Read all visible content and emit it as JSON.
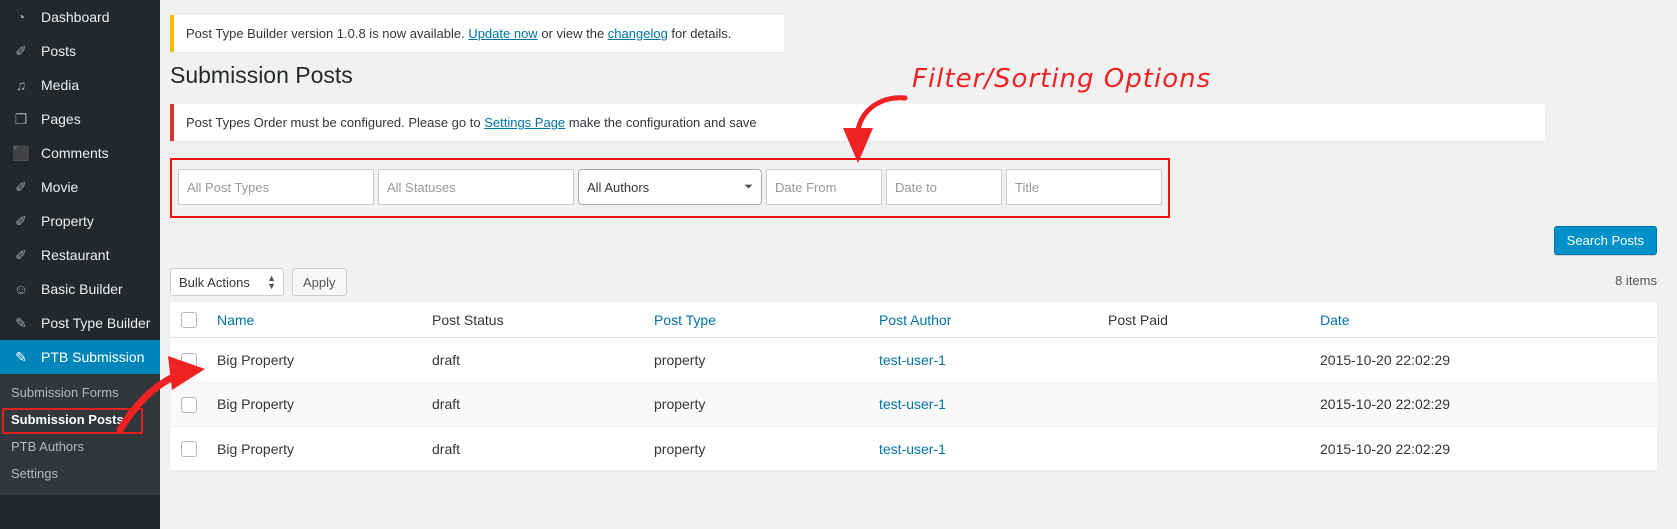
{
  "sidebar": {
    "items": [
      {
        "label": "Dashboard",
        "icon": "dashboard-icon",
        "glyph": "◔"
      },
      {
        "label": "Posts",
        "icon": "pin-icon",
        "glyph": "✐"
      },
      {
        "label": "Media",
        "icon": "media-icon",
        "glyph": "♫"
      },
      {
        "label": "Pages",
        "icon": "pages-icon",
        "glyph": "❐"
      },
      {
        "label": "Comments",
        "icon": "comments-icon",
        "glyph": "⬛"
      },
      {
        "label": "Movie",
        "icon": "pin-icon",
        "glyph": "✐"
      },
      {
        "label": "Property",
        "icon": "pin-icon",
        "glyph": "✐"
      },
      {
        "label": "Restaurant",
        "icon": "pin-icon",
        "glyph": "✐"
      },
      {
        "label": "Basic Builder",
        "icon": "smiley-icon",
        "glyph": "☺"
      },
      {
        "label": "Post Type Builder",
        "icon": "pencil-square-icon",
        "glyph": "✎"
      },
      {
        "label": "PTB Submission",
        "icon": "pencil-square-icon",
        "glyph": "✎"
      }
    ],
    "submenu": [
      {
        "label": "Submission Forms",
        "current": false
      },
      {
        "label": "Submission Posts",
        "current": true
      },
      {
        "label": "PTB Authors",
        "current": false
      },
      {
        "label": "Settings",
        "current": false
      }
    ]
  },
  "notices": {
    "update": {
      "text_before": "Post Type Builder version 1.0.8 is now available. ",
      "link1": "Update now",
      "text_middle": " or view the ",
      "link2": "changelog",
      "text_after": " for details."
    },
    "error": {
      "text_before": "Post Types Order must be configured. Please go to ",
      "link": "Settings Page",
      "text_after": " make the configuration and save"
    }
  },
  "page": {
    "title": "Submission Posts"
  },
  "filters": {
    "post_types_placeholder": "All Post Types",
    "statuses_placeholder": "All Statuses",
    "authors_value": "All Authors",
    "date_from_placeholder": "Date From",
    "date_to_placeholder": "Date to",
    "title_placeholder": "Title",
    "search_button": "Search Posts"
  },
  "tablenav": {
    "bulk_actions": "Bulk Actions",
    "apply_button": "Apply",
    "items_count": "8 items"
  },
  "table": {
    "columns": [
      {
        "label": "Name",
        "sortable": true
      },
      {
        "label": "Post Status",
        "sortable": false
      },
      {
        "label": "Post Type",
        "sortable": true
      },
      {
        "label": "Post Author",
        "sortable": true
      },
      {
        "label": "Post Paid",
        "sortable": false
      },
      {
        "label": "Date",
        "sortable": true
      }
    ],
    "rows": [
      {
        "name": "Big Property",
        "post_status": "draft",
        "post_type": "property",
        "post_author": "test-user-1",
        "post_paid": "",
        "date": "2015-10-20 22:02:29"
      },
      {
        "name": "Big Property",
        "post_status": "draft",
        "post_type": "property",
        "post_author": "test-user-1",
        "post_paid": "",
        "date": "2015-10-20 22:02:29"
      },
      {
        "name": "Big Property",
        "post_status": "draft",
        "post_type": "property",
        "post_author": "test-user-1",
        "post_paid": "",
        "date": "2015-10-20 22:02:29"
      }
    ]
  },
  "annotations": {
    "filter_label": "Filter/Sorting  Options",
    "color": "#ee2222"
  }
}
